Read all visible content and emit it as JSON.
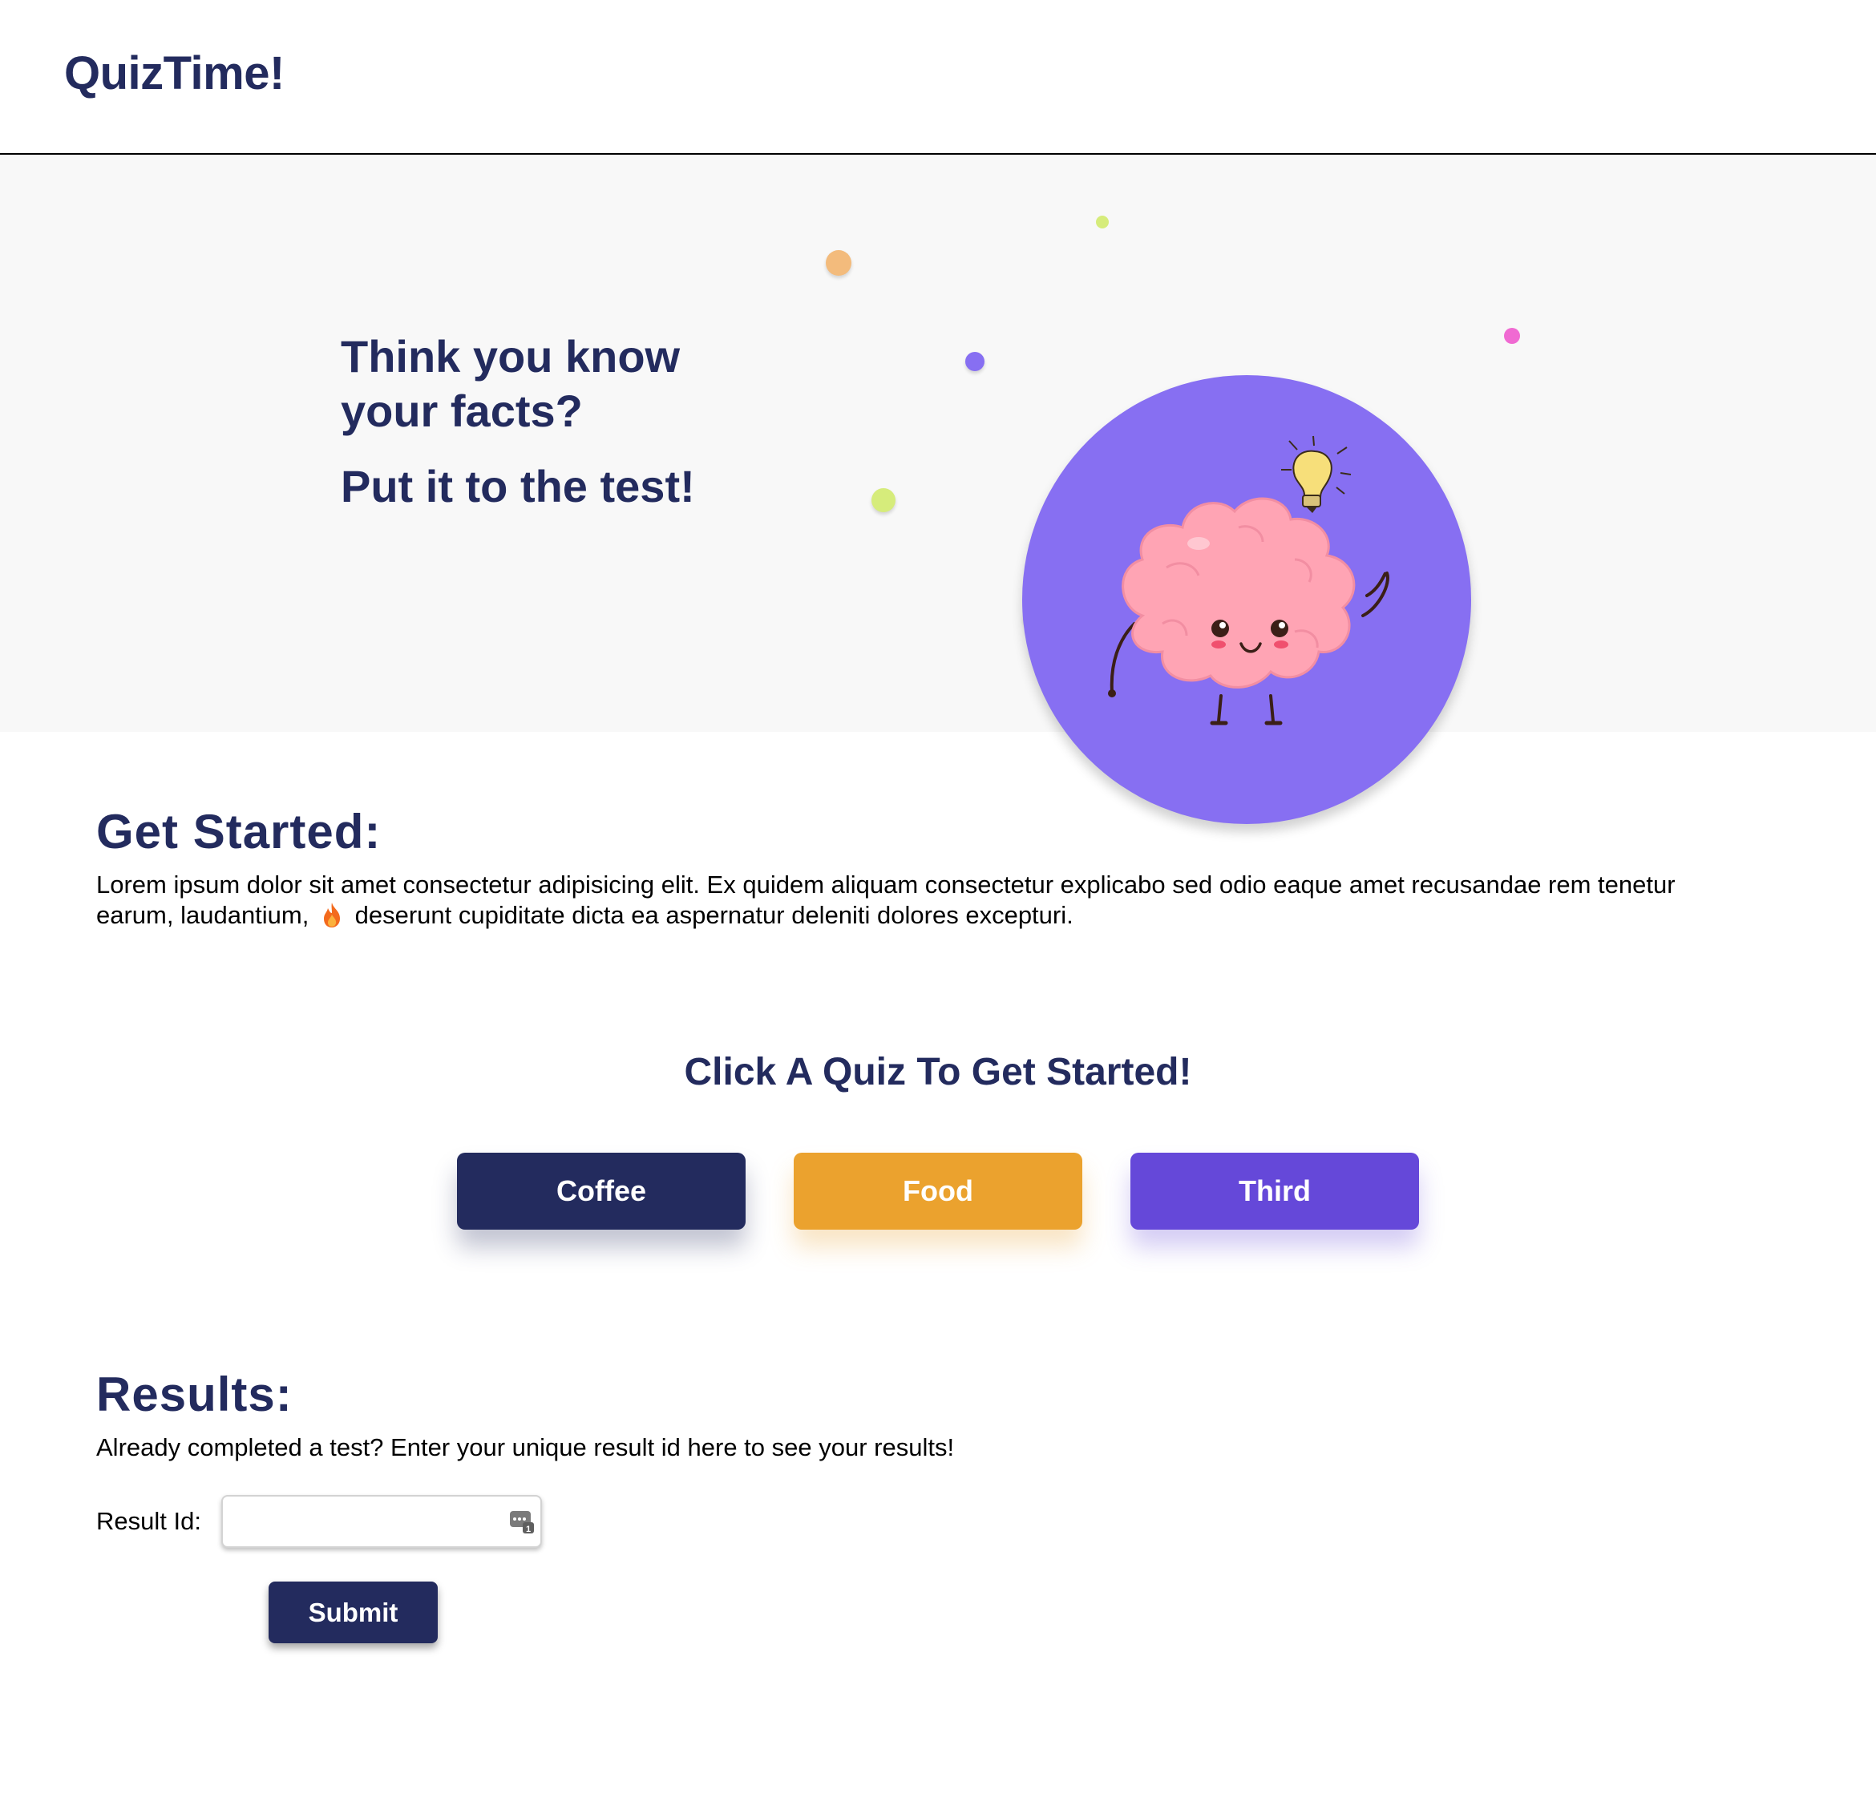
{
  "header": {
    "brand": "QuizTime!"
  },
  "hero": {
    "line1": "Think you know",
    "line2": "your facts?",
    "line3": "Put it to the test!",
    "illustration": "brain-mascot-with-lightbulb",
    "circle_color": "#876ff2"
  },
  "get_started": {
    "title": "Get Started:",
    "text_line1": "Lorem ipsum dolor sit amet consectetur adipisicing elit. Ex quidem aliquam consectetur explicabo sed odio eaque amet recusandae rem tenetur",
    "text_line2_before": "earum, laudantium,",
    "text_emoji": "fire-icon",
    "text_line2_after": "deserunt cupiditate dicta ea aspernatur deleniti dolores excepturi."
  },
  "quizzes": {
    "title": "Click A Quiz To Get Started!",
    "buttons": [
      {
        "label": "Coffee",
        "color": "#232b5e"
      },
      {
        "label": "Food",
        "color": "#eba22e"
      },
      {
        "label": "Third",
        "color": "#6548d9"
      }
    ]
  },
  "results": {
    "title": "Results:",
    "description": "Already completed a test? Enter your unique result id here to see your results!",
    "field_label": "Result Id:",
    "field_value": "",
    "submit_label": "Submit"
  },
  "colors": {
    "primary": "#232b5e",
    "accent_orange": "#eba22e",
    "accent_purple": "#6548d9",
    "hero_bg": "#f8f8f8"
  }
}
